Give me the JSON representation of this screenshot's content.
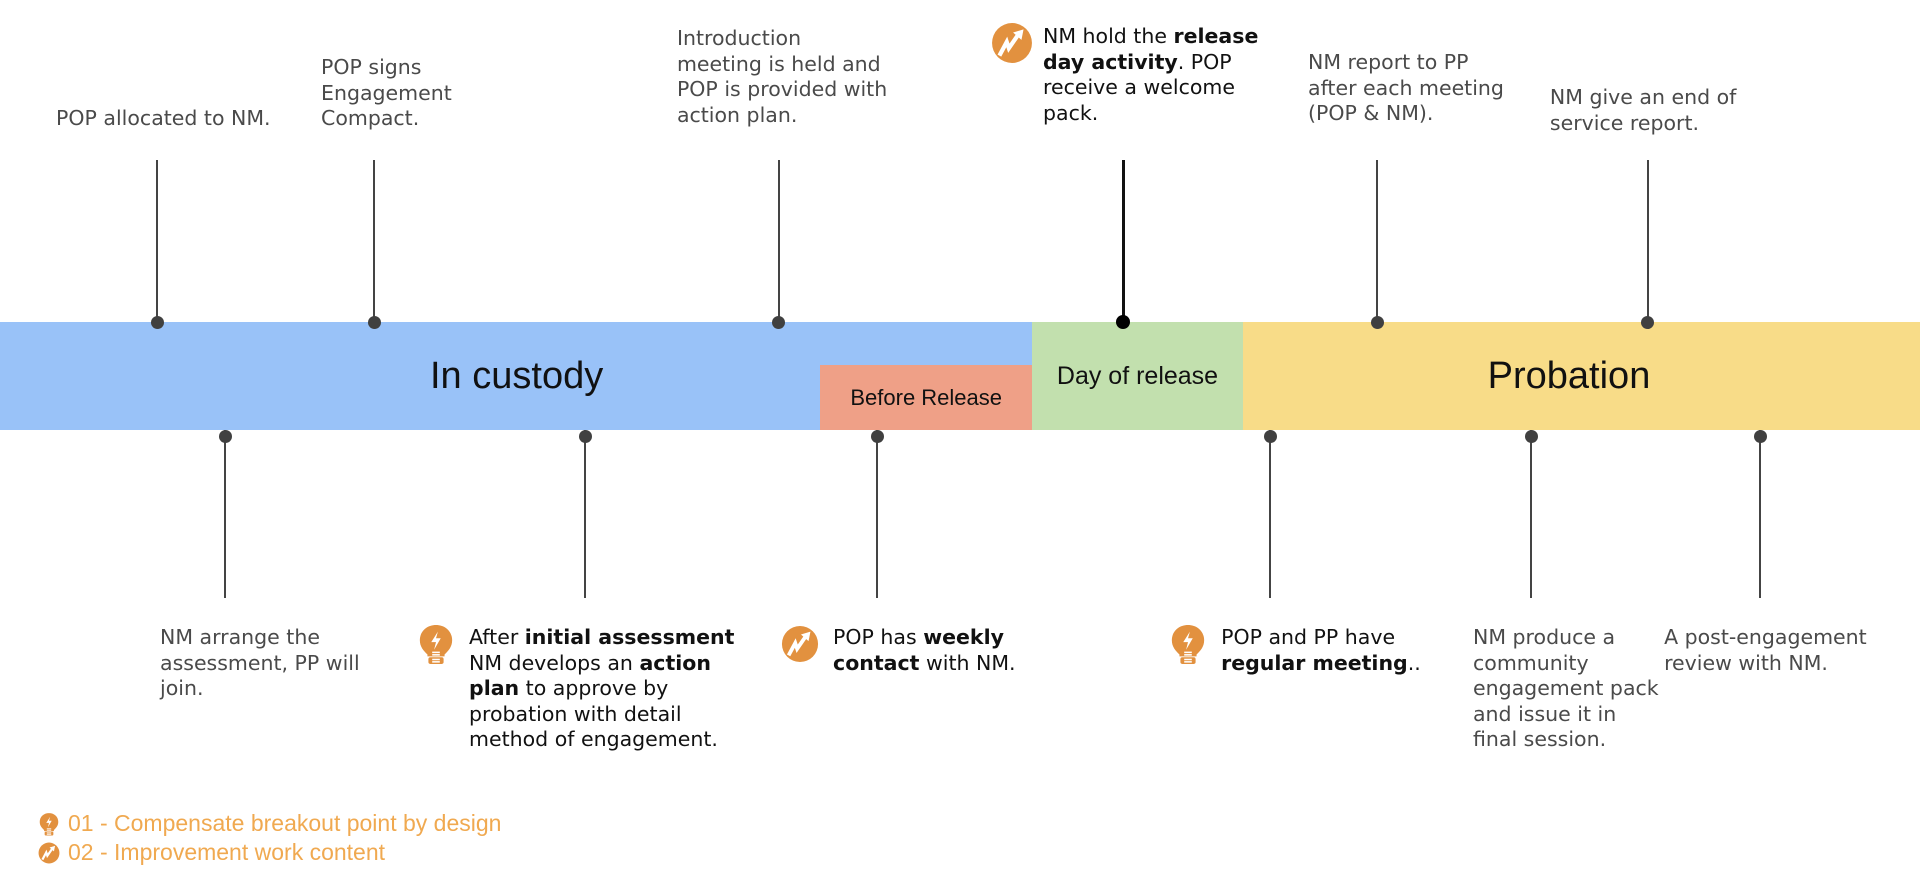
{
  "colors": {
    "custody": "#99c2f8",
    "before_release": "#efa087",
    "day_of_release": "#c2e0ae",
    "probation": "#f8dc88",
    "icon_orange": "#e2913f",
    "legend_text": "#f0a950"
  },
  "phases": [
    {
      "id": "custody",
      "label": "In custody",
      "start": 0.0,
      "end": 0.5375,
      "size": "lg",
      "layer": "main"
    },
    {
      "id": "before_release",
      "label": "Before Release",
      "start": 0.4273,
      "end": 0.5375,
      "size": "sm",
      "layer": "sub"
    },
    {
      "id": "day_of_release",
      "label": "Day of release",
      "start": 0.5375,
      "end": 0.6474,
      "size": "md",
      "layer": "main"
    },
    {
      "id": "probation",
      "label": "Probation",
      "start": 0.6474,
      "end": 1.0,
      "size": "lg",
      "layer": "main"
    }
  ],
  "events_above": [
    {
      "pos": 0.0818,
      "text": "POP allocated to NM.",
      "icon": null,
      "emphasis": false,
      "lines": 1
    },
    {
      "pos": 0.1948,
      "text": "POP signs\nEngagement\nCompact.",
      "icon": null,
      "emphasis": false,
      "lines": 3
    },
    {
      "pos": 0.4057,
      "text": "Introduction\nmeeting is held and\nPOP is provided with\naction plan.",
      "icon": null,
      "emphasis": false,
      "lines": 4
    },
    {
      "pos": 0.5849,
      "html_parts": [
        {
          "t": "NM hold the "
        },
        {
          "t": "release\nday activity",
          "b": true
        },
        {
          "t": ". POP\nreceive a welcome\npack."
        }
      ],
      "icon": "improvement-icon",
      "emphasis": true,
      "lines": 4
    },
    {
      "pos": 0.7172,
      "text": "NM report to PP\nafter each meeting\n(POP & NM).",
      "icon": null,
      "emphasis": false,
      "lines": 3
    },
    {
      "pos": 0.8583,
      "text": "NM give an end of\nservice report.",
      "icon": null,
      "emphasis": false,
      "lines": 2
    }
  ],
  "events_below": [
    {
      "pos": 0.1172,
      "text": "NM arrange the\nassessment, PP will\njoin.",
      "icon": null,
      "emphasis": false
    },
    {
      "pos": 0.3047,
      "html_parts": [
        {
          "t": "After "
        },
        {
          "t": "initial assessment",
          "b": true
        },
        {
          "t": "\nNM develops an "
        },
        {
          "t": "action\nplan",
          "b": true
        },
        {
          "t": " to approve by\nprobation with detail\nmethod of engagement."
        }
      ],
      "icon": "bulb-icon",
      "emphasis": true
    },
    {
      "pos": 0.4568,
      "html_parts": [
        {
          "t": "POP has "
        },
        {
          "t": "weekly\ncontact",
          "b": true
        },
        {
          "t": " with NM."
        }
      ],
      "icon": "improvement-icon",
      "emphasis": true
    },
    {
      "pos": 0.6615,
      "html_parts": [
        {
          "t": "POP and PP have\n"
        },
        {
          "t": "regular meeting",
          "b": true
        },
        {
          "t": ".."
        }
      ],
      "icon": "bulb-icon",
      "emphasis": true
    },
    {
      "pos": 0.7974,
      "text": "NM produce a\ncommunity\nengagement pack\nand issue it in\nfinal session.",
      "icon": null,
      "emphasis": false
    },
    {
      "pos": 0.9167,
      "text": "A post-engagement\nreview with NM.",
      "icon": null,
      "emphasis": false
    }
  ],
  "legend": [
    {
      "icon": "bulb-icon",
      "label": "01 - Compensate breakout point by design"
    },
    {
      "icon": "improvement-icon",
      "label": "02 - Improvement work content"
    }
  ]
}
